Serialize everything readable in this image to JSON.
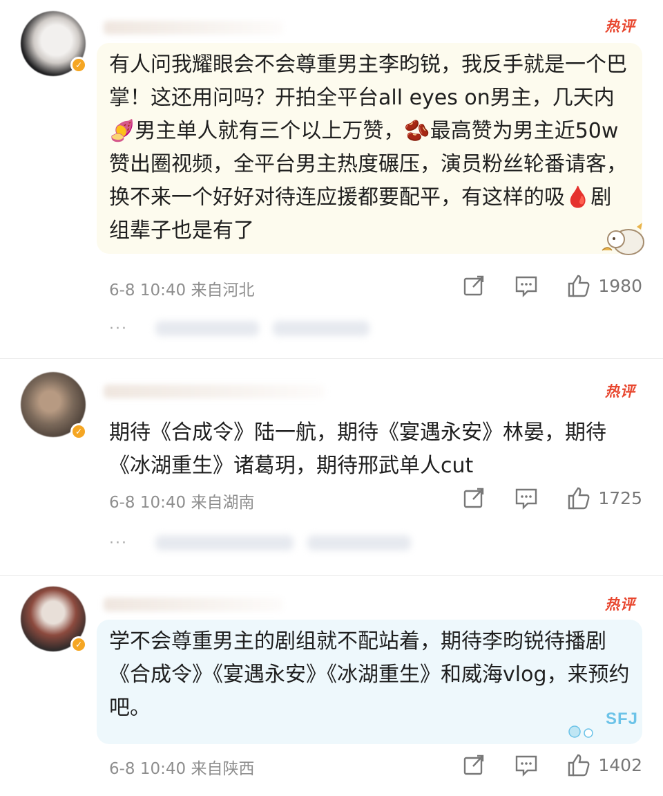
{
  "comments": [
    {
      "hot_label": "热评",
      "text": "有人问我耀眼会不会尊重男主李昀锐，我反手就是一个巴掌！这还用问吗？开拍全平台all eyes on男主，几天内🍠男主单人就有三个以上万赞，🫘最高赞为男主近50w赞出圈视频，全平台男主热度碾压，演员粉丝轮番请客，换不来一个好好对待连应援都要配平，有这样的吸🩸剧组辈子也是有了",
      "meta": "6-8 10:40  来自河北",
      "likes": "1980",
      "reply_dots": "···"
    },
    {
      "hot_label": "热评",
      "text": "期待《合成令》陆一航，期待《宴遇永安》林晏，期待《冰湖重生》诸葛玥，期待邢武单人cut",
      "meta": "6-8 10:40  来自湖南",
      "likes": "1725",
      "reply_dots": "···"
    },
    {
      "hot_label": "热评",
      "text": "学不会尊重男主的剧组就不配站着，期待李昀锐待播剧《合成令》《宴遇永安》《冰湖重生》和威海vlog，来预约吧。",
      "meta": "6-8 10:40  来自陕西",
      "likes": "1402",
      "sticker_text": "SFJ"
    }
  ],
  "icons": {
    "share": "share-icon",
    "comment": "comment-icon",
    "like": "thumbs-up-icon",
    "verified": "verified-badge-icon"
  },
  "colors": {
    "hot": "#e8472f",
    "verified": "#f5a623",
    "bubble_yellow": "#fdfbee",
    "bubble_blue": "#eef8fc"
  }
}
